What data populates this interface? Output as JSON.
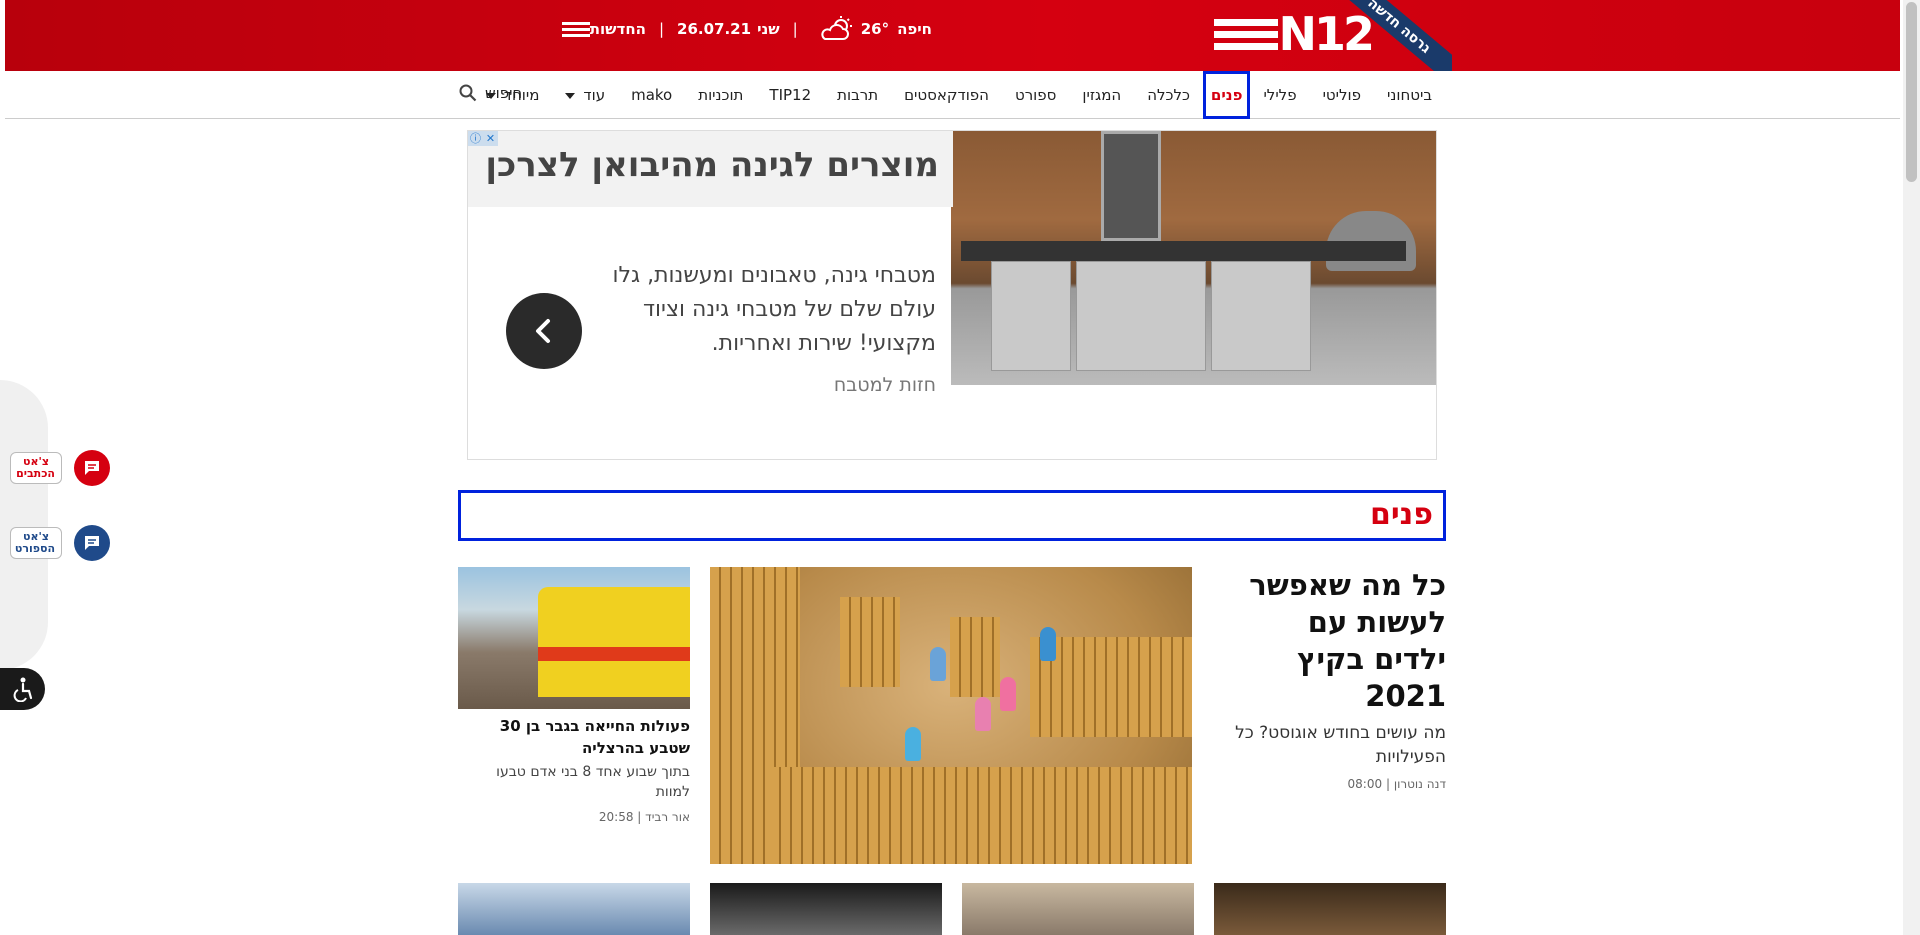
{
  "header": {
    "ribbon_label": "גרסה חדשה",
    "logo_text": "N12",
    "weather_city": "חיפה",
    "weather_temp": "26°",
    "date_day": "שני",
    "date": "26.07.21",
    "separator": "|",
    "menu_label": "החדשות"
  },
  "nav": {
    "items": [
      {
        "label": "ביטחוני"
      },
      {
        "label": "פוליטי"
      },
      {
        "label": "פלילי"
      },
      {
        "label": "פנים",
        "active": true
      },
      {
        "label": "כלכלה"
      },
      {
        "label": "המגזין"
      },
      {
        "label": "ספורט"
      },
      {
        "label": "הפודקאסטים"
      },
      {
        "label": "תרבות"
      },
      {
        "label": "TIP12"
      },
      {
        "label": "תוכניות"
      },
      {
        "label": "mako"
      },
      {
        "label": "עוד"
      },
      {
        "label": "מיוחד"
      }
    ],
    "search_label": "חיפוש"
  },
  "ad": {
    "headline": "מוצרים לגינה מהיבואן לצרכן",
    "body": "מטבחי גינה, טאבונים ומעשנות, גלו עולם שלם של מטבחי גינה וציוד מקצועי! שירות ואחריות.",
    "brand": "חזות למטבח",
    "info_glyph": "ⓘ",
    "close_glyph": "✕"
  },
  "section": {
    "title": "פנים"
  },
  "main_article": {
    "title": "כל מה שאפשר לעשות עם ילדים בקיץ 2021",
    "subtitle": "מה עושים בחודש אוגוסט? כל הפעילויות",
    "author": "דנה נוטרון",
    "time": "08:00"
  },
  "side_article": {
    "title": "פעולות החייאה בגבר בן 30 שטבע בהרצליה",
    "subtitle": "בתוך שבוע אחד 8 בני אדם טבעו למוות",
    "author": "אור רביד",
    "time": "20:58"
  },
  "widgets": {
    "chat_writers": "צ'אט הכתבים",
    "chat_sport": "צ'אט הספורט"
  },
  "colors": {
    "brand_red": "#d50010",
    "highlight_blue": "#0022dd",
    "sport_blue": "#1f4a8a"
  }
}
